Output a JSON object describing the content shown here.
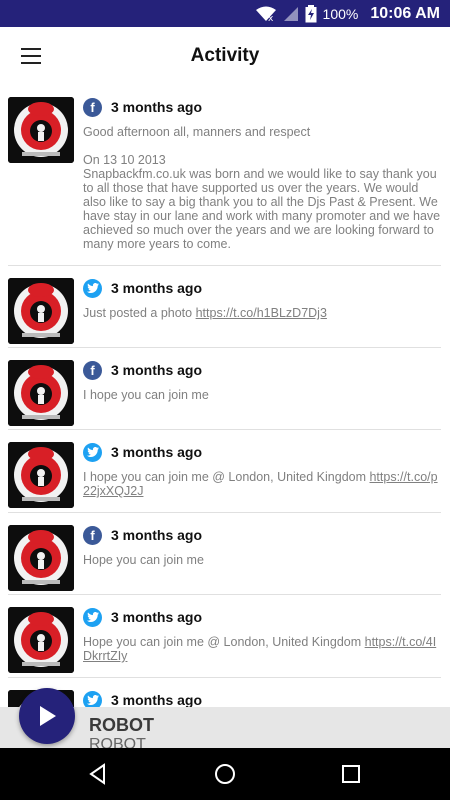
{
  "status_bar": {
    "battery": "100%",
    "time": "10:06 AM"
  },
  "app_bar": {
    "title": "Activity"
  },
  "posts": [
    {
      "source": "facebook",
      "time": "3 months ago",
      "text": "Good afternoon all, manners and respect\n\nOn 13 10 2013\nSnapbackfm.co.uk was born and we would like to say thank you to all those that have supported us over the years.  We would also like to say a big thank you to all the Djs Past & Present. We have stay in our lane and work with many promoter and we have achieved so much over the years and we are looking forward to many more years to come.",
      "link": ""
    },
    {
      "source": "twitter",
      "time": "3 months ago",
      "text": "Just posted a photo ",
      "link": "https://t.co/h1BLzD7Dj3"
    },
    {
      "source": "facebook",
      "time": "3 months ago",
      "text": "I hope you can join me",
      "link": ""
    },
    {
      "source": "twitter",
      "time": "3 months ago",
      "text": "I hope you can join me @ London, United Kingdom ",
      "link": "https://t.co/p22jxXQJ2J"
    },
    {
      "source": "facebook",
      "time": "3 months ago",
      "text": "Hope you can join me",
      "link": ""
    },
    {
      "source": "twitter",
      "time": "3 months ago",
      "text": "Hope you can join me @ London, United Kingdom ",
      "link": "https://t.co/4IDkrrtZIy"
    },
    {
      "source": "twitter",
      "time": "3 months ago",
      "text": "",
      "link": ""
    }
  ],
  "player": {
    "title": "ROBOT",
    "subtitle": "ROBOT"
  },
  "colors": {
    "primary": "#25227a",
    "facebook": "#3b5998",
    "twitter": "#1da1f2",
    "logo_red": "#d81f26"
  },
  "icons": {
    "menu": "hamburger-icon",
    "play": "play-icon",
    "back": "back-icon",
    "home": "home-icon",
    "recents": "recents-icon"
  }
}
